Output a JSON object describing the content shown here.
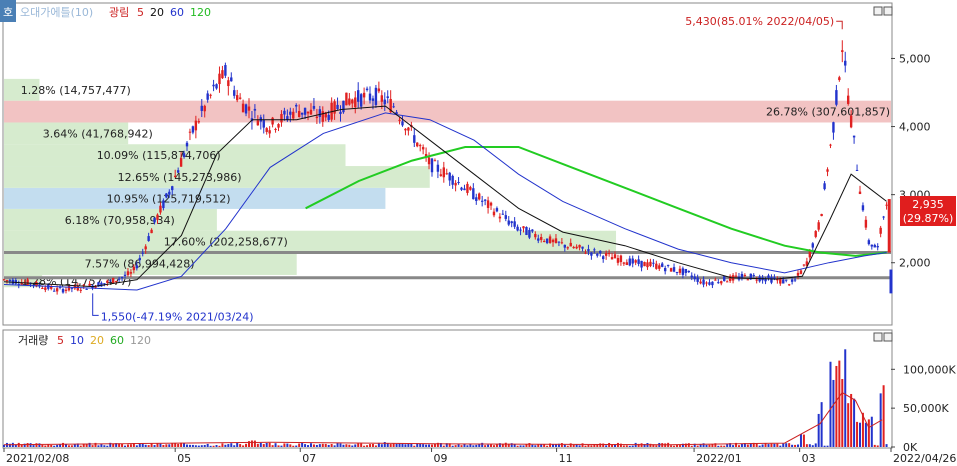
{
  "corner_label": "호",
  "price_panel": {
    "legend": [
      {
        "text": "오대가에틀(10)",
        "color": "#9ab8d8"
      },
      {
        "text": "광림",
        "color": "#cc2222"
      },
      {
        "text": "5",
        "color": "#cc2222"
      },
      {
        "text": "20",
        "color": "#111111"
      },
      {
        "text": "60",
        "color": "#2233cc"
      },
      {
        "text": "120",
        "color": "#22bb22"
      }
    ],
    "y_ticks": [
      "5,000",
      "4,000",
      "3,000",
      "2,000"
    ],
    "y_tick_values": [
      5000,
      4000,
      3000,
      2000
    ],
    "current_price": "2,935",
    "current_change": "(29.87%)",
    "high_annotation": "5,430(85.01% 2022/04/05)",
    "low_annotation": "1,550(-47.19% 2021/03/24)",
    "high_value": 5430,
    "low_value": 1550,
    "last_value": 2935,
    "ylim": [
      1100,
      5800
    ]
  },
  "volume_panel": {
    "legend": [
      {
        "text": "거래량",
        "color": "#222222"
      },
      {
        "text": "5",
        "color": "#cc2222"
      },
      {
        "text": "10",
        "color": "#2233cc"
      },
      {
        "text": "20",
        "color": "#ddaa22"
      },
      {
        "text": "60",
        "color": "#22aa22"
      },
      {
        "text": "120",
        "color": "#999999"
      }
    ],
    "y_ticks": [
      "100,000K",
      "50,000K",
      "0K"
    ],
    "y_tick_values": [
      100000,
      50000,
      0
    ],
    "ylim": [
      0,
      130000
    ]
  },
  "x_axis": {
    "labels": [
      "2021/02/08",
      "05",
      "07",
      "09",
      "11",
      "2022/01",
      "03",
      "2022/04/26"
    ],
    "label_positions": [
      0.0,
      0.193,
      0.334,
      0.482,
      0.623,
      0.778,
      0.897,
      1.0
    ]
  },
  "chart_data": {
    "type": "candlestick",
    "volume_profile": [
      {
        "label": "1.28% (14,757,477)",
        "low": 1640,
        "high": 1820,
        "pct": 0.043,
        "color": "#cfe8c6"
      },
      {
        "label": "7.57% (86,994,428)",
        "low": 1820,
        "high": 2160,
        "pct": 0.33,
        "color": "#cfe8c6"
      },
      {
        "label": "17.60% (202,258,677)",
        "low": 2160,
        "high": 2470,
        "pct": 0.69,
        "color": "#cfe8c6"
      },
      {
        "label": "6.18% (70,958,934)",
        "low": 2470,
        "high": 2790,
        "pct": 0.24,
        "color": "#cfe8c6"
      },
      {
        "label": "10.95% (125,719,512)",
        "low": 2790,
        "high": 3100,
        "pct": 0.43,
        "color": "#b9d7ec"
      },
      {
        "label": "12.65% (145,273,986)",
        "low": 3100,
        "high": 3420,
        "pct": 0.48,
        "color": "#cfe8c6"
      },
      {
        "label": "10.09% (115,874,706)",
        "low": 3420,
        "high": 3740,
        "pct": 0.385,
        "color": "#cfe8c6"
      },
      {
        "label": "3.64% (41,768,942)",
        "low": 3740,
        "high": 4060,
        "pct": 0.14,
        "color": "#cfe8c6"
      },
      {
        "label": "26.78% (307,601,857)",
        "low": 4060,
        "high": 4380,
        "pct": 1.0,
        "color": "#f0b8b8"
      },
      {
        "label": "1.28% (14,757,477)",
        "low": 4380,
        "high": 4700,
        "pct": 0.04,
        "color": "#cfe8c6"
      }
    ],
    "price_path": [
      [
        0.0,
        1750
      ],
      [
        0.03,
        1700
      ],
      [
        0.06,
        1600
      ],
      [
        0.09,
        1640
      ],
      [
        0.12,
        1720
      ],
      [
        0.145,
        1850
      ],
      [
        0.155,
        2100
      ],
      [
        0.17,
        2600
      ],
      [
        0.185,
        3000
      ],
      [
        0.2,
        3500
      ],
      [
        0.215,
        4000
      ],
      [
        0.235,
        4500
      ],
      [
        0.25,
        4800
      ],
      [
        0.265,
        4400
      ],
      [
        0.28,
        4200
      ],
      [
        0.3,
        4000
      ],
      [
        0.33,
        4250
      ],
      [
        0.36,
        4150
      ],
      [
        0.39,
        4400
      ],
      [
        0.42,
        4450
      ],
      [
        0.44,
        4300
      ],
      [
        0.46,
        3900
      ],
      [
        0.48,
        3450
      ],
      [
        0.5,
        3300
      ],
      [
        0.52,
        3100
      ],
      [
        0.54,
        2900
      ],
      [
        0.56,
        2700
      ],
      [
        0.58,
        2500
      ],
      [
        0.6,
        2400
      ],
      [
        0.62,
        2300
      ],
      [
        0.65,
        2200
      ],
      [
        0.68,
        2100
      ],
      [
        0.71,
        2000
      ],
      [
        0.74,
        1950
      ],
      [
        0.77,
        1850
      ],
      [
        0.79,
        1700
      ],
      [
        0.81,
        1750
      ],
      [
        0.84,
        1800
      ],
      [
        0.87,
        1750
      ],
      [
        0.89,
        1700
      ],
      [
        0.905,
        2000
      ],
      [
        0.92,
        2600
      ],
      [
        0.935,
        4000
      ],
      [
        0.945,
        5200
      ],
      [
        0.955,
        4100
      ],
      [
        0.965,
        3100
      ],
      [
        0.975,
        2300
      ],
      [
        0.985,
        2200
      ],
      [
        0.995,
        2935
      ]
    ],
    "ma20_path": [
      [
        0.0,
        1720
      ],
      [
        0.1,
        1650
      ],
      [
        0.15,
        1750
      ],
      [
        0.2,
        2400
      ],
      [
        0.24,
        3600
      ],
      [
        0.28,
        4100
      ],
      [
        0.33,
        4100
      ],
      [
        0.38,
        4250
      ],
      [
        0.43,
        4300
      ],
      [
        0.48,
        3800
      ],
      [
        0.53,
        3300
      ],
      [
        0.58,
        2800
      ],
      [
        0.63,
        2450
      ],
      [
        0.7,
        2250
      ],
      [
        0.76,
        2000
      ],
      [
        0.82,
        1780
      ],
      [
        0.87,
        1760
      ],
      [
        0.9,
        1800
      ],
      [
        0.93,
        2600
      ],
      [
        0.955,
        3300
      ],
      [
        0.975,
        3100
      ],
      [
        0.995,
        2900
      ]
    ],
    "ma60_path": [
      [
        0.0,
        1680
      ],
      [
        0.15,
        1600
      ],
      [
        0.2,
        1800
      ],
      [
        0.25,
        2500
      ],
      [
        0.3,
        3400
      ],
      [
        0.36,
        3900
      ],
      [
        0.43,
        4200
      ],
      [
        0.48,
        4100
      ],
      [
        0.53,
        3800
      ],
      [
        0.58,
        3300
      ],
      [
        0.63,
        2900
      ],
      [
        0.7,
        2500
      ],
      [
        0.76,
        2200
      ],
      [
        0.82,
        2000
      ],
      [
        0.88,
        1850
      ],
      [
        0.93,
        2000
      ],
      [
        0.97,
        2100
      ],
      [
        0.995,
        2150
      ]
    ],
    "ma120_path": [
      [
        0.34,
        2800
      ],
      [
        0.4,
        3200
      ],
      [
        0.46,
        3500
      ],
      [
        0.52,
        3700
      ],
      [
        0.58,
        3700
      ],
      [
        0.64,
        3400
      ],
      [
        0.7,
        3100
      ],
      [
        0.76,
        2800
      ],
      [
        0.82,
        2500
      ],
      [
        0.88,
        2250
      ],
      [
        0.92,
        2150
      ],
      [
        0.96,
        2100
      ],
      [
        0.995,
        2150
      ]
    ],
    "hlines": [
      2150,
      1780
    ],
    "volume_spikes": [
      [
        0.28,
        9000
      ],
      [
        0.36,
        6000
      ],
      [
        0.43,
        8000
      ],
      [
        0.5,
        5000
      ],
      [
        0.62,
        4000
      ],
      [
        0.76,
        3500
      ],
      [
        0.9,
        25000
      ],
      [
        0.92,
        60000
      ],
      [
        0.935,
        110000
      ],
      [
        0.945,
        130000
      ],
      [
        0.955,
        80000
      ],
      [
        0.965,
        50000
      ],
      [
        0.975,
        40000
      ],
      [
        0.99,
        90000
      ]
    ],
    "volume_ma5_path": [
      [
        0.0,
        3000
      ],
      [
        0.3,
        6000
      ],
      [
        0.5,
        4000
      ],
      [
        0.75,
        3000
      ],
      [
        0.88,
        5000
      ],
      [
        0.92,
        30000
      ],
      [
        0.945,
        70000
      ],
      [
        0.96,
        60000
      ],
      [
        0.975,
        25000
      ],
      [
        0.99,
        35000
      ]
    ]
  }
}
